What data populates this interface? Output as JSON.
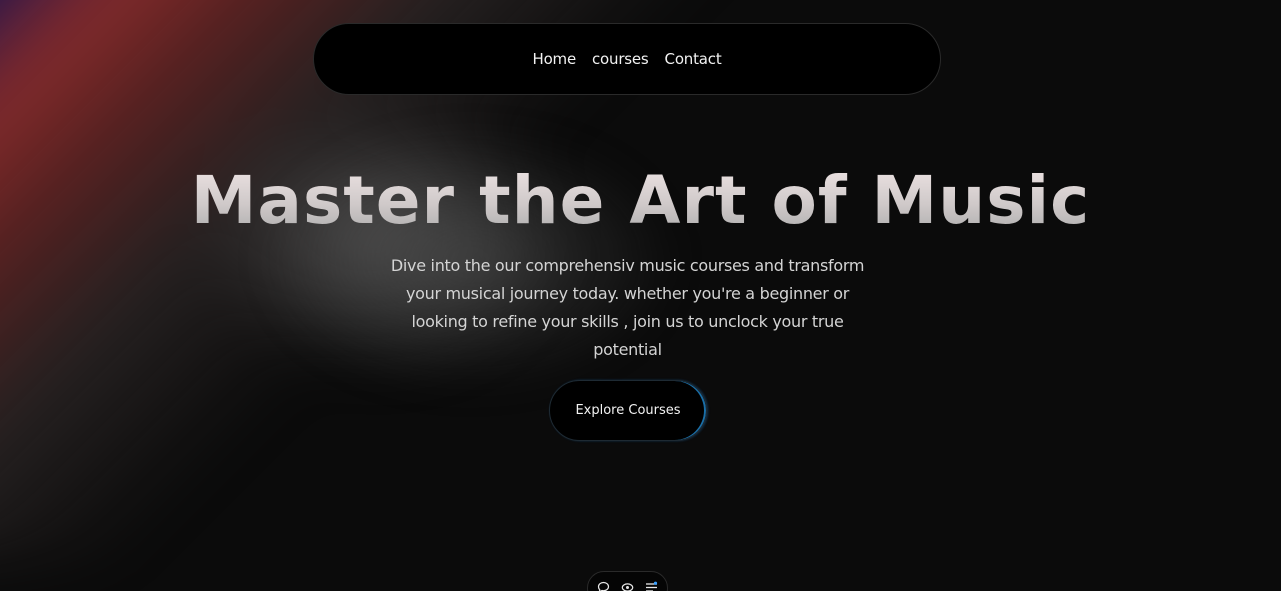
{
  "nav": {
    "links": [
      {
        "label": "Home"
      },
      {
        "label": "courses"
      },
      {
        "label": "Contact"
      }
    ]
  },
  "hero": {
    "title": "Master the Art of Music",
    "subtitle": "Dive into the our comprehensiv music courses and transform your musical journey today. whether you're a beginner or looking to refine your skills , join us to unclock your true potential",
    "cta_label": "Explore Courses"
  },
  "toolbar": {
    "icons": [
      "chat-bubble-icon",
      "eye-icon",
      "settings-sliders-icon"
    ]
  },
  "colors": {
    "background": "#0b0b0b",
    "navbar": "#000000",
    "accent_blue": "#1a6fa8",
    "glow_red": "#8c2d2d",
    "glow_blue": "#0e1064"
  }
}
